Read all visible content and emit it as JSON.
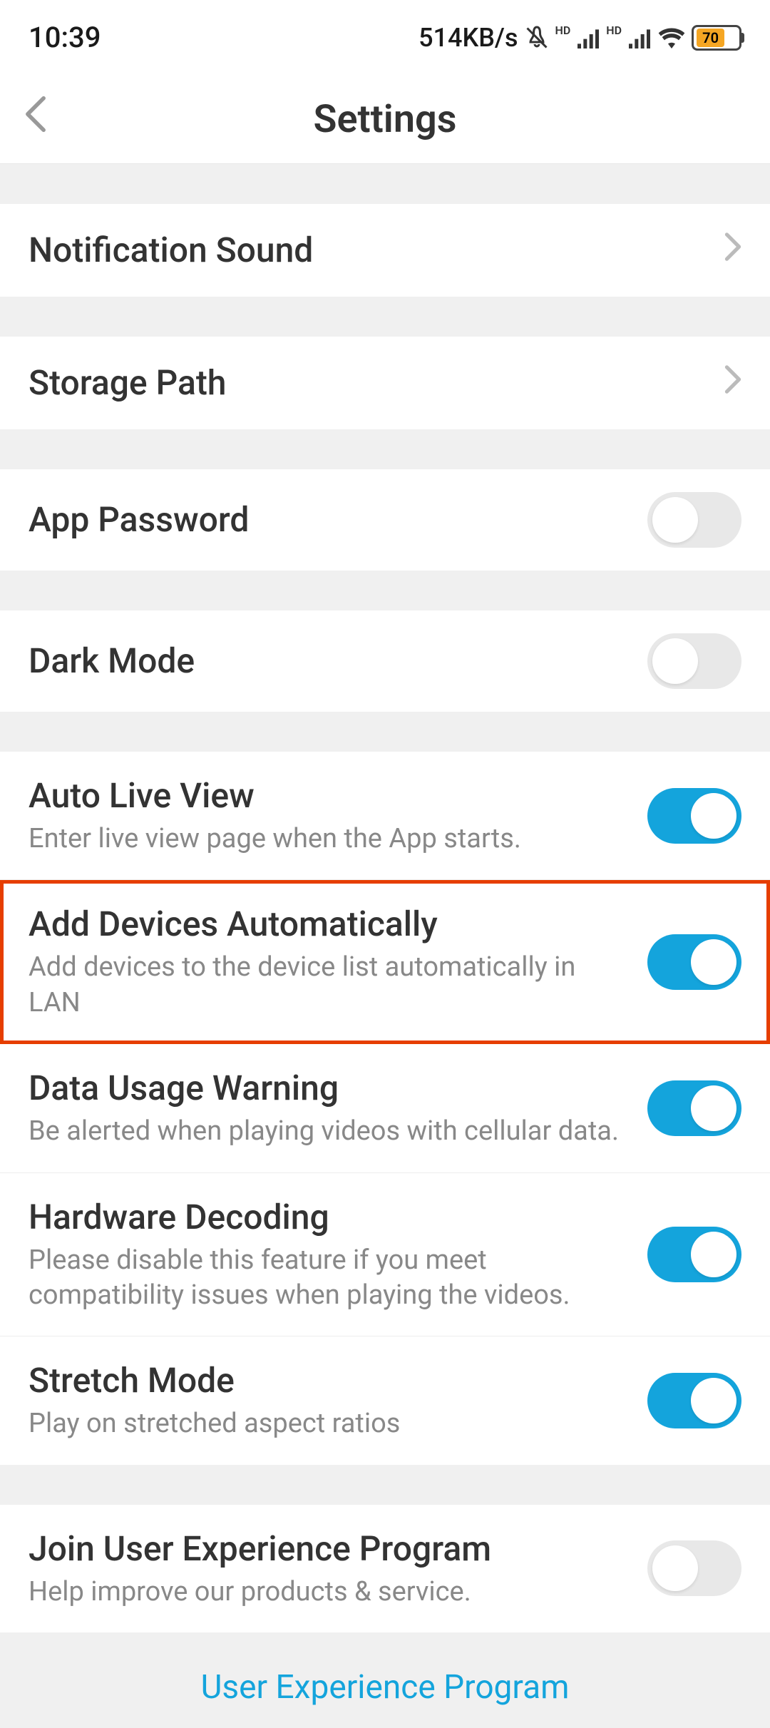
{
  "status_bar": {
    "time": "10:39",
    "net_speed": "514KB/s",
    "battery_level": "70"
  },
  "header": {
    "title": "Settings"
  },
  "items": {
    "notification_sound": {
      "title": "Notification Sound"
    },
    "storage_path": {
      "title": "Storage Path"
    },
    "app_password": {
      "title": "App Password"
    },
    "dark_mode": {
      "title": "Dark Mode"
    },
    "auto_live_view": {
      "title": "Auto Live View",
      "subtitle": "Enter live view page when the App starts."
    },
    "add_devices": {
      "title": "Add Devices Automatically",
      "subtitle": "Add devices to the device list automatically in LAN"
    },
    "data_usage": {
      "title": "Data Usage Warning",
      "subtitle": "Be alerted when playing videos with cellular data."
    },
    "hardware_decoding": {
      "title": "Hardware Decoding",
      "subtitle": "Please disable this feature if you meet compatibility issues when playing the videos."
    },
    "stretch_mode": {
      "title": "Stretch Mode",
      "subtitle": "Play on stretched aspect ratios"
    },
    "join_uep": {
      "title": "Join User Experience Program",
      "subtitle": "Help improve our products & service."
    }
  },
  "footer": {
    "link": "User Experience Program"
  }
}
